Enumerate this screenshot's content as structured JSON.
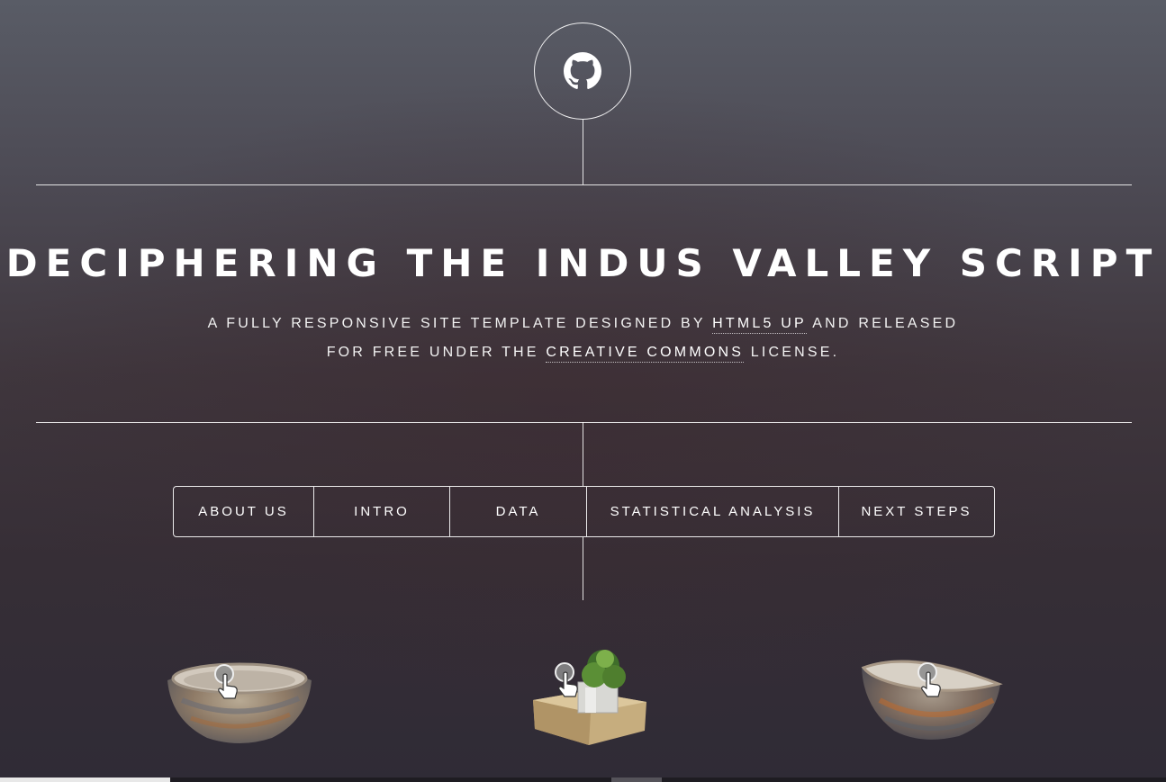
{
  "header": {
    "logo_icon": "github-icon",
    "title": "DECIPHERING THE INDUS VALLEY SCRIPT",
    "subtitle_line1_pre": "A FULLY RESPONSIVE SITE TEMPLATE DESIGNED BY ",
    "subtitle_link1": "HTML5 UP",
    "subtitle_line1_post": " AND RELEASED",
    "subtitle_line2_pre": "FOR FREE UNDER THE ",
    "subtitle_link2": "CREATIVE COMMONS",
    "subtitle_line2_post": " LICENSE."
  },
  "nav": {
    "items": [
      {
        "label": "ABOUT US"
      },
      {
        "label": "INTRO"
      },
      {
        "label": "DATA"
      },
      {
        "label": "STATISTICAL ANALYSIS"
      },
      {
        "label": "NEXT STEPS"
      }
    ]
  },
  "models": [
    {
      "name": "stone-bowl-model",
      "icon": "touch-icon"
    },
    {
      "name": "tree-on-block-model",
      "icon": "touch-icon"
    },
    {
      "name": "stone-bowl-model-2",
      "icon": "touch-icon"
    }
  ],
  "colors": {
    "text": "#ffffff",
    "background_top": "#595c66",
    "background_bottom": "#2f2b36"
  }
}
